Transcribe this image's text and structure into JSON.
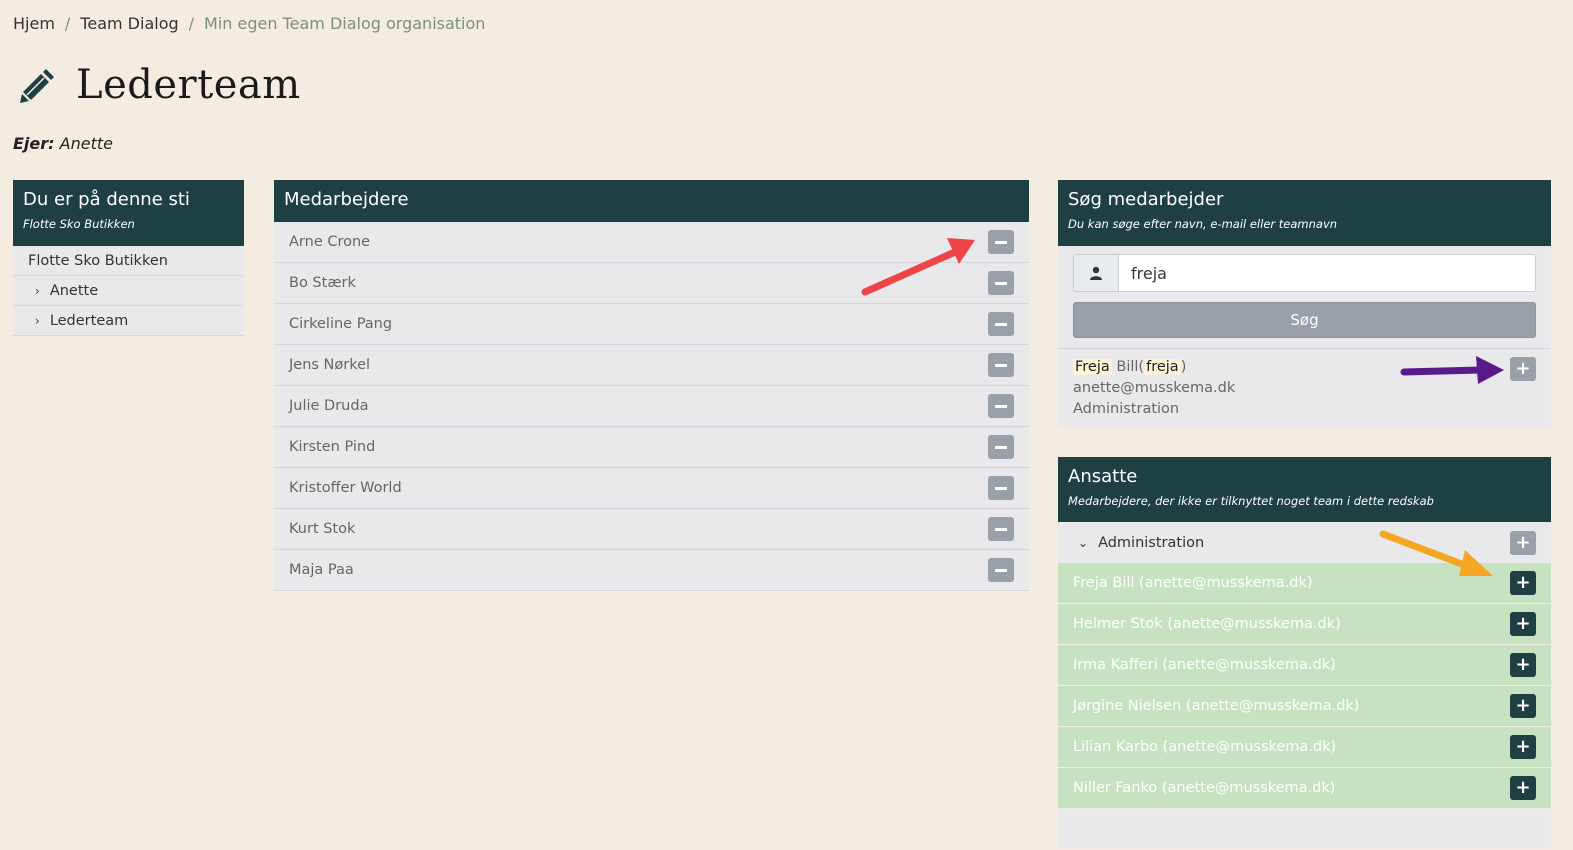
{
  "breadcrumb": {
    "items": [
      "Hjem",
      "Team Dialog",
      "Min egen Team Dialog organisation"
    ],
    "separator": "/"
  },
  "page": {
    "title": "Lederteam",
    "owner_label": "Ejer:",
    "owner_name": "Anette"
  },
  "path_panel": {
    "title": "Du er på denne sti",
    "subtitle": "Flotte Sko Butikken",
    "items": [
      "Flotte Sko Butikken",
      "Anette",
      "Lederteam"
    ]
  },
  "members_panel": {
    "title": "Medarbejdere",
    "members": [
      "Arne Crone",
      "Bo Stærk",
      "Cirkeline Pang",
      "Jens Nørkel",
      "Julie Druda",
      "Kirsten Pind",
      "Kristoffer World",
      "Kurt Stok",
      "Maja Paa"
    ]
  },
  "search_panel": {
    "title": "Søg medarbejder",
    "subtitle": "Du kan søge efter navn, e-mail eller teamnavn",
    "input_value": "freja",
    "button_label": "Søg",
    "result": {
      "first_name": "Freja",
      "last_name": "Bill",
      "username": "freja",
      "paren_open": "(",
      "paren_close": ")",
      "email": "anette@musskema.dk",
      "department": "Administration"
    }
  },
  "employees_panel": {
    "title": "Ansatte",
    "subtitle": "Medarbejdere, der ikke er tilknyttet noget team i dette redskab",
    "group": "Administration",
    "employees": [
      "Freja Bill (anette@musskema.dk)",
      "Helmer Stok (anette@musskema.dk)",
      "Irma Kafferi (anette@musskema.dk)",
      "Jørgine Nielsen (anette@musskema.dk)",
      "Lilian Karbo (anette@musskema.dk)",
      "Niller Fanko (anette@musskema.dk)"
    ]
  },
  "icons": {
    "title": "pencil-icon",
    "search_addon": "user-icon",
    "remove": "minus-icon",
    "add": "plus-icon",
    "chevron_right": "chevron-right-icon",
    "chevron_down": "chevron-down-icon"
  },
  "colors": {
    "background": "#f5ece1",
    "panel_header": "#1f4043",
    "row": "#e9e9ec",
    "employee_row": "#c7e2c0",
    "grey_button": "#9aa0a8",
    "arrow_red": "#ef4446",
    "arrow_purple": "#5b1a8c",
    "arrow_orange": "#f5a623"
  }
}
